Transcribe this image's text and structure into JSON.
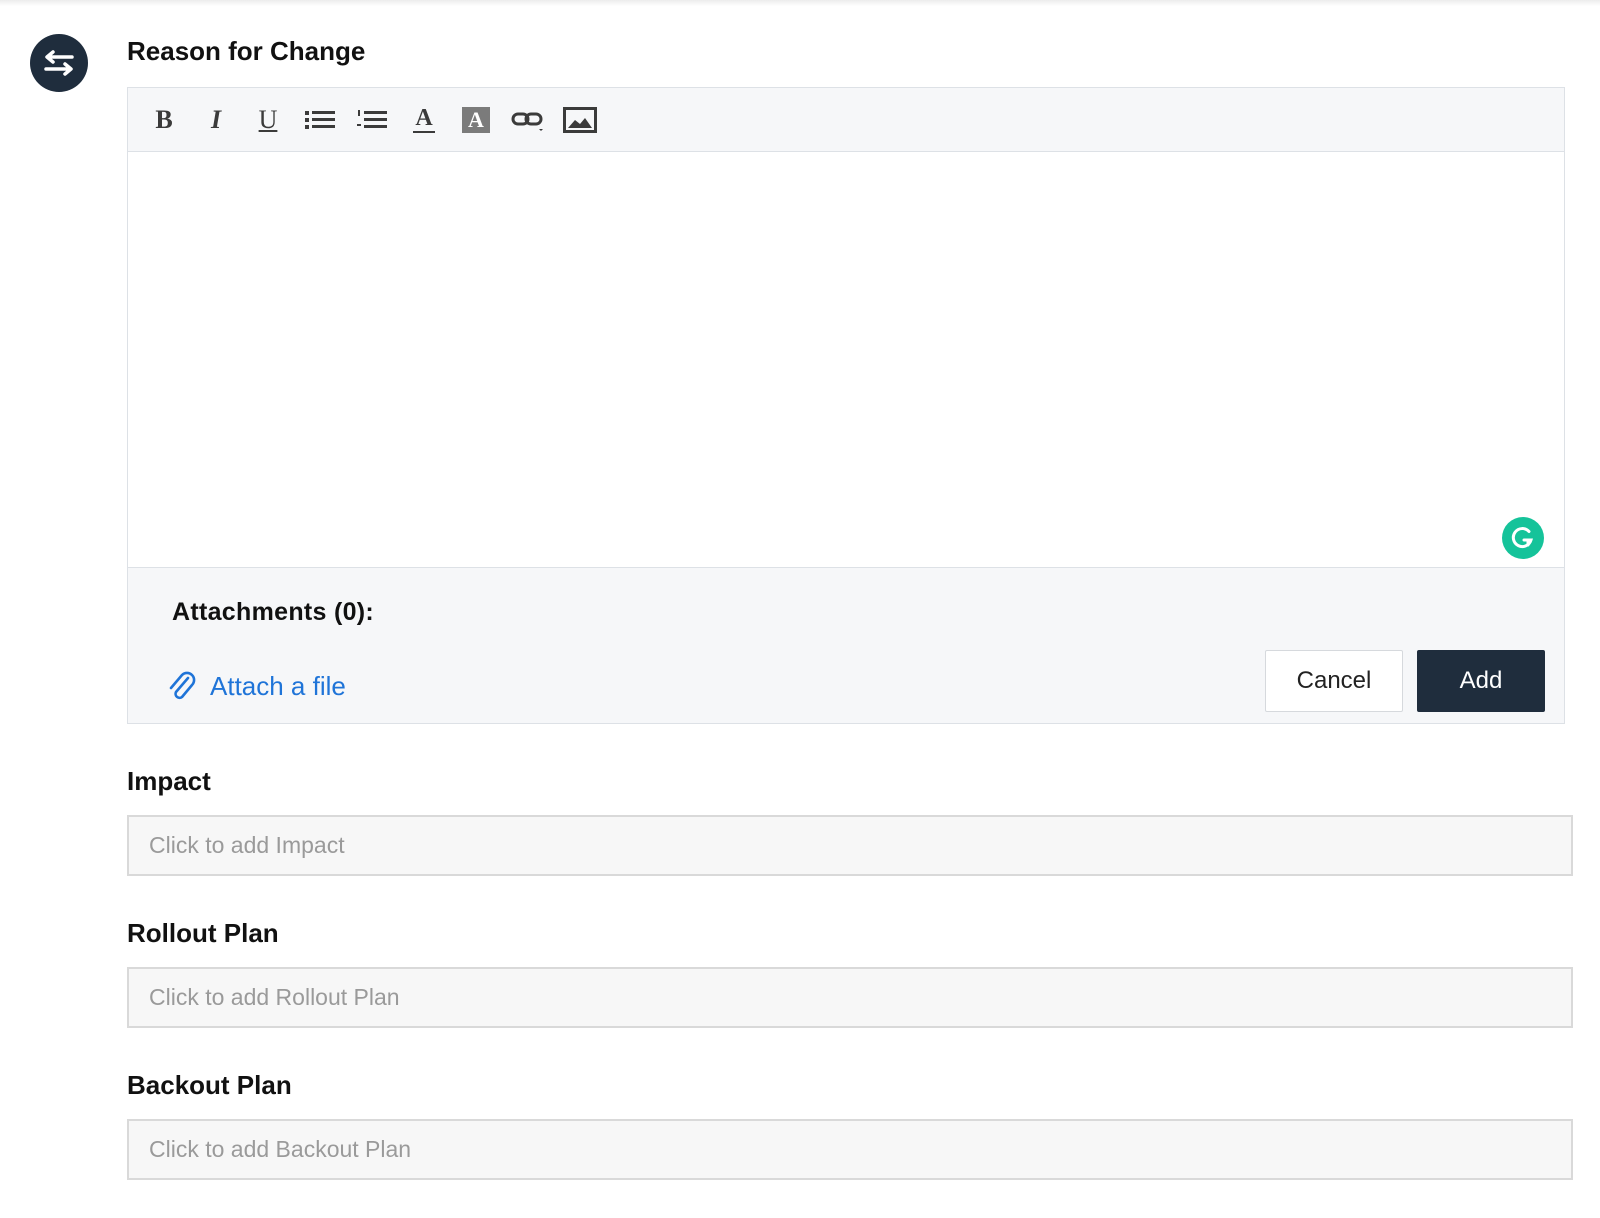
{
  "reason_section": {
    "title": "Reason for Change",
    "toolbar": {
      "bold": "B",
      "italic": "I",
      "underline": "U",
      "text_color": "A",
      "highlight": "A"
    },
    "attachments_label": "Attachments (0):",
    "attach_link": "Attach a file",
    "cancel_label": "Cancel",
    "add_label": "Add"
  },
  "fields": {
    "impact": {
      "label": "Impact",
      "placeholder": "Click to add Impact"
    },
    "rollout": {
      "label": "Rollout Plan",
      "placeholder": "Click to add Rollout Plan"
    },
    "backout": {
      "label": "Backout Plan",
      "placeholder": "Click to add Backout Plan"
    }
  },
  "colors": {
    "primary_dark": "#1f2d3d",
    "link_blue": "#1f74d8",
    "grammarly_green": "#15c39a"
  },
  "icons": [
    "change-arrows-icon",
    "bulleted-list-icon",
    "numbered-list-icon",
    "link-icon",
    "image-icon",
    "grammarly-icon",
    "paperclip-icon"
  ]
}
